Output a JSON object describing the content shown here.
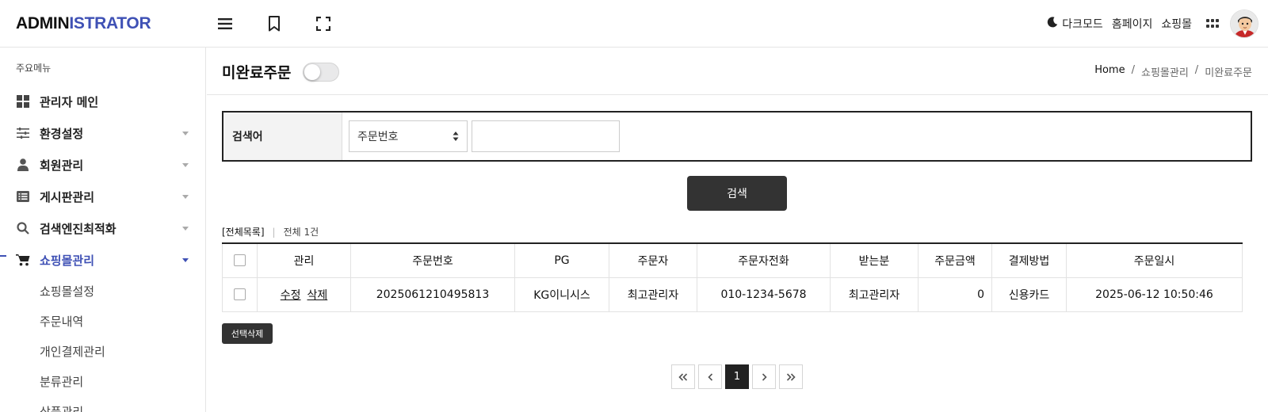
{
  "header": {
    "logo_part1": "ADMIN",
    "logo_part2": "ISTRATOR",
    "menu_icon": "hamburger-icon",
    "bookmark_icon": "bookmark-icon",
    "fullscreen_icon": "fullscreen-icon",
    "dark_mode": "다크모드",
    "homepage": "홈페이지",
    "shop": "쇼핑몰",
    "apps_icon": "apps-grid-icon",
    "colors": {
      "brand": "#3f51b5",
      "text": "#111111"
    }
  },
  "sidebar": {
    "title": "주요메뉴",
    "items": [
      {
        "label": "관리자 메인",
        "icon": "dashboard-icon",
        "has_submenu": false
      },
      {
        "label": "환경설정",
        "icon": "sliders-icon",
        "has_submenu": true
      },
      {
        "label": "회원관리",
        "icon": "user-icon",
        "has_submenu": true
      },
      {
        "label": "게시판관리",
        "icon": "list-icon",
        "has_submenu": true
      },
      {
        "label": "검색엔진최적화",
        "icon": "search-icon",
        "has_submenu": true
      },
      {
        "label": "쇼핑몰관리",
        "icon": "cart-icon",
        "has_submenu": true,
        "active": true
      }
    ],
    "submenu": [
      "쇼핑몰설정",
      "주문내역",
      "개인결제관리",
      "분류관리",
      "상품관리"
    ]
  },
  "page": {
    "title": "미완료주문",
    "toggle_on": false,
    "breadcrumb": [
      "Home",
      "쇼핑몰관리",
      "미완료주문"
    ]
  },
  "search": {
    "label": "검색어",
    "select_value": "주문번호",
    "input_value": "",
    "button": "검색"
  },
  "list": {
    "all_label": "[전체목록]",
    "count_label": "전체 1건",
    "columns": [
      "관리",
      "주문번호",
      "PG",
      "주문자",
      "주문자전화",
      "받는분",
      "주문금액",
      "결제방법",
      "주문일시"
    ],
    "rows": [
      {
        "edit": "수정",
        "delete": "삭제",
        "order_no": "2025061210495813",
        "pg": "KG이니시스",
        "orderer": "최고관리자",
        "phone": "010-1234-5678",
        "receiver": "최고관리자",
        "amount": "0",
        "payment": "신용카드",
        "date": "2025-06-12 10:50:46"
      }
    ],
    "delete_selected": "선택삭제"
  },
  "pagination": {
    "current": "1",
    "first_icon": "double-chevron-left-icon",
    "prev_icon": "chevron-left-icon",
    "next_icon": "chevron-right-icon",
    "last_icon": "double-chevron-right-icon"
  }
}
